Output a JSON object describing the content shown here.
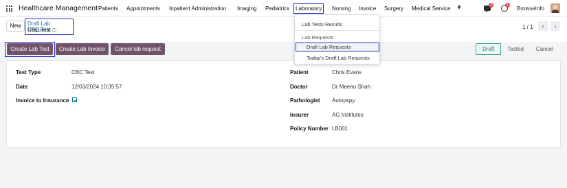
{
  "navbar": {
    "brand": "Healthcare Management",
    "menu": [
      "Patients",
      "Appointments",
      "Inpatient Administration",
      "Imaging",
      "Pediatrics",
      "Laboratory",
      "Nursing",
      "Invoice",
      "Surgery",
      "Medical Service"
    ],
    "active_menu": "Laboratory",
    "plus": "+",
    "chat_badge": "3",
    "activity_badge": "1",
    "user": "BrowseInfo"
  },
  "control": {
    "new_label": "New",
    "breadcrumb_parent": "Draft Lab Requests",
    "breadcrumb_current": "CBC Test",
    "pager": "1 / 1",
    "prev": "‹",
    "next": "›"
  },
  "actions": {
    "create_lab_test": "Create Lab Test",
    "create_lab_invoice": "Create Lab Invoice",
    "cancel_lab_request": "Cancel lab request"
  },
  "status": [
    "Draft",
    "Tested",
    "Cancel"
  ],
  "status_active": "Draft",
  "form": {
    "left": [
      {
        "label": "Test Type",
        "value": "CBC Test"
      },
      {
        "label": "Date",
        "value": "12/03/2024 10:35:57"
      },
      {
        "label": "Invoice to Insurance",
        "value": "checked"
      }
    ],
    "right": [
      {
        "label": "Patient",
        "value": "Chris Evans"
      },
      {
        "label": "Doctor",
        "value": "Dr Meenu Shah"
      },
      {
        "label": "Pathologist",
        "value": "Autopspy"
      },
      {
        "label": "Insurer",
        "value": "AG Institutes"
      },
      {
        "label": "Policy Number",
        "value": "LB001"
      }
    ]
  },
  "dropdown": {
    "item1": "Lab Tests Results",
    "header": "Lab Requests",
    "item2": "Draft Lab Requests",
    "item3": "Today's Draft Lab Requests"
  },
  "colors": {
    "primary": "#71536c",
    "highlight": "#1b2ac9",
    "status_active": "#3ea39a"
  }
}
